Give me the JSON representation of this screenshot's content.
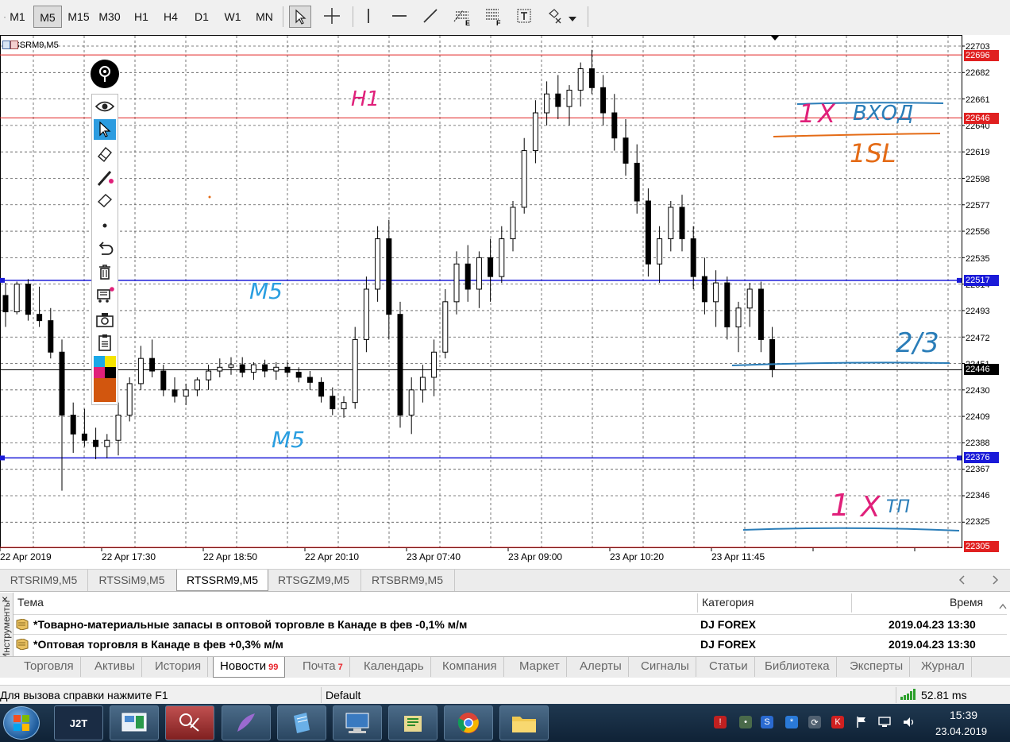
{
  "toolbar": {
    "timeframes": [
      "M1",
      "M5",
      "M15",
      "M30",
      "H1",
      "H4",
      "D1",
      "W1",
      "MN"
    ],
    "active_timeframe": "M5",
    "tools": [
      "cursor-icon",
      "crosshair-icon",
      "vertical-line-icon",
      "horizontal-line-icon",
      "trendline-icon",
      "fibonacci-icon",
      "fibonacci-fan-icon",
      "text-icon",
      "shapes-icon"
    ]
  },
  "chart": {
    "symbol_label": "RTSSRM9,M5",
    "price_labels": [
      "22703",
      "22682",
      "22661",
      "22640",
      "22619",
      "22598",
      "22577",
      "22556",
      "22535",
      "22514",
      "22493",
      "22472",
      "22451",
      "22430",
      "22409",
      "22388",
      "22367",
      "22346",
      "22325"
    ],
    "marked_prices": [
      {
        "value": "22696",
        "color": "#e02020"
      },
      {
        "value": "22646",
        "color": "#e02020"
      },
      {
        "value": "22517",
        "color": "#1a1ad8"
      },
      {
        "value": "22446",
        "color": "#000000"
      },
      {
        "value": "22376",
        "color": "#1a1ad8"
      },
      {
        "value": "22305",
        "color": "#e02020"
      }
    ],
    "time_labels": [
      "22 Apr 2019",
      "22 Apr 17:30",
      "22 Apr 18:50",
      "22 Apr 20:10",
      "23 Apr 07:40",
      "23 Apr 09:00",
      "23 Apr 10:20",
      "23 Apr 11:45"
    ],
    "annotations": [
      {
        "text": "H1",
        "color": "#e0207a"
      },
      {
        "text": "M5",
        "color": "#2a9ee0"
      },
      {
        "text": "M5",
        "color": "#2a9ee0"
      },
      {
        "text": "1",
        "color": "#e0207a"
      },
      {
        "text": "X",
        "color": "#e0207a"
      },
      {
        "text": "ВХОД",
        "color": "#2a7db8"
      },
      {
        "text": "1SL",
        "color": "#e46b16"
      },
      {
        "text": "2/3",
        "color": "#2a7db8"
      },
      {
        "text": "1",
        "color": "#e0207a"
      },
      {
        "text": "X",
        "color": "#e0207a"
      },
      {
        "text": "ТП",
        "color": "#2a7db8"
      }
    ],
    "draw_tools": [
      "pin-icon",
      "eye-icon",
      "select-arrow-icon",
      "eraser-icon",
      "pen-icon",
      "highlighter-icon",
      "dot-icon",
      "undo-icon",
      "trash-icon",
      "cart-icon",
      "camera-icon",
      "clipboard-icon",
      "palette-icon"
    ]
  },
  "symbol_tabs": [
    "RTSRIM9,M5",
    "RTSSiM9,M5",
    "RTSSRM9,M5",
    "RTSGZM9,M5",
    "RTSBRM9,M5"
  ],
  "active_symbol_tab": "RTSSRM9,M5",
  "news": {
    "columns": {
      "subject": "Тема",
      "category": "Категория",
      "time": "Время"
    },
    "rows": [
      {
        "subject": "*Товарно-материальные запасы в оптовой торговле в Канаде в фев -0,1% м/м",
        "category": "DJ FOREX",
        "time": "2019.04.23 13:30"
      },
      {
        "subject": "*Оптовая торговля в Канаде в фев +0,3% м/м",
        "category": "DJ FOREX",
        "time": "2019.04.23 13:30"
      }
    ],
    "sidebar_label": "Инструменты"
  },
  "bottom_tabs": [
    {
      "label": "Торговля",
      "badge": ""
    },
    {
      "label": "Активы",
      "badge": ""
    },
    {
      "label": "История",
      "badge": ""
    },
    {
      "label": "Новости",
      "badge": "99"
    },
    {
      "label": "Почта",
      "badge": "7"
    },
    {
      "label": "Календарь",
      "badge": ""
    },
    {
      "label": "Компания",
      "badge": ""
    },
    {
      "label": "Маркет",
      "badge": ""
    },
    {
      "label": "Алерты",
      "badge": ""
    },
    {
      "label": "Сигналы",
      "badge": ""
    },
    {
      "label": "Статьи",
      "badge": ""
    },
    {
      "label": "Библиотека",
      "badge": ""
    },
    {
      "label": "Эксперты",
      "badge": ""
    },
    {
      "label": "Журнал",
      "badge": ""
    }
  ],
  "active_bottom_tab": "Новости",
  "status": {
    "help": "Для вызова справки нажмите F1",
    "profile": "Default",
    "ping": "52.81 ms"
  },
  "taskbar": {
    "apps": [
      "windows-start",
      "j2t",
      "dashboard",
      "snipping-tool",
      "feather",
      "notepad",
      "remote-desktop",
      "library",
      "chrome",
      "file-explorer"
    ],
    "time": "15:39",
    "date": "23.04.2019",
    "j2t_label": "J2T"
  }
}
